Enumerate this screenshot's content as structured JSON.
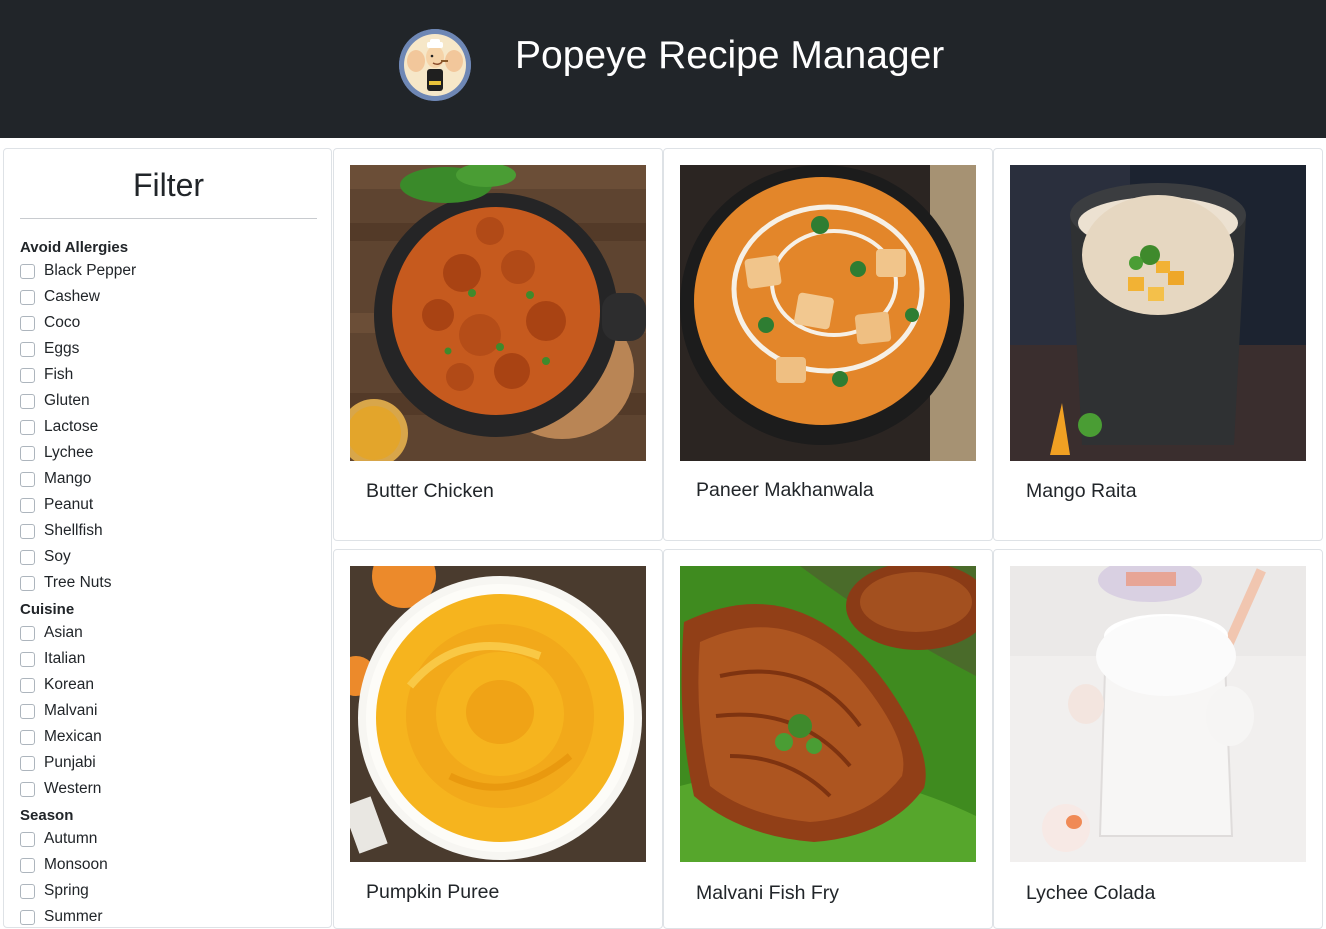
{
  "header": {
    "title": "Popeye Recipe Manager",
    "logo_icon": "popeye-logo"
  },
  "filter": {
    "title": "Filter",
    "groups": [
      {
        "title": "Avoid Allergies",
        "options": [
          "Black Pepper",
          "Cashew",
          "Coco",
          "Eggs",
          "Fish",
          "Gluten",
          "Lactose",
          "Lychee",
          "Mango",
          "Peanut",
          "Shellfish",
          "Soy",
          "Tree Nuts"
        ]
      },
      {
        "title": "Cuisine",
        "options": [
          "Asian",
          "Italian",
          "Korean",
          "Malvani",
          "Mexican",
          "Punjabi",
          "Western"
        ]
      },
      {
        "title": "Season",
        "options": [
          "Autumn",
          "Monsoon",
          "Spring",
          "Summer"
        ]
      }
    ]
  },
  "recipes": [
    {
      "name": "Butter Chicken",
      "image": "butter-chicken-photo"
    },
    {
      "name": "Paneer Makhanwala",
      "image": "paneer-makhanwala-photo"
    },
    {
      "name": "Mango Raita",
      "image": "mango-raita-photo"
    },
    {
      "name": "Pumpkin Puree",
      "image": "pumpkin-puree-photo"
    },
    {
      "name": "Malvani Fish Fry",
      "image": "malvani-fish-fry-photo"
    },
    {
      "name": "Lychee Colada",
      "image": "lychee-colada-photo"
    }
  ]
}
